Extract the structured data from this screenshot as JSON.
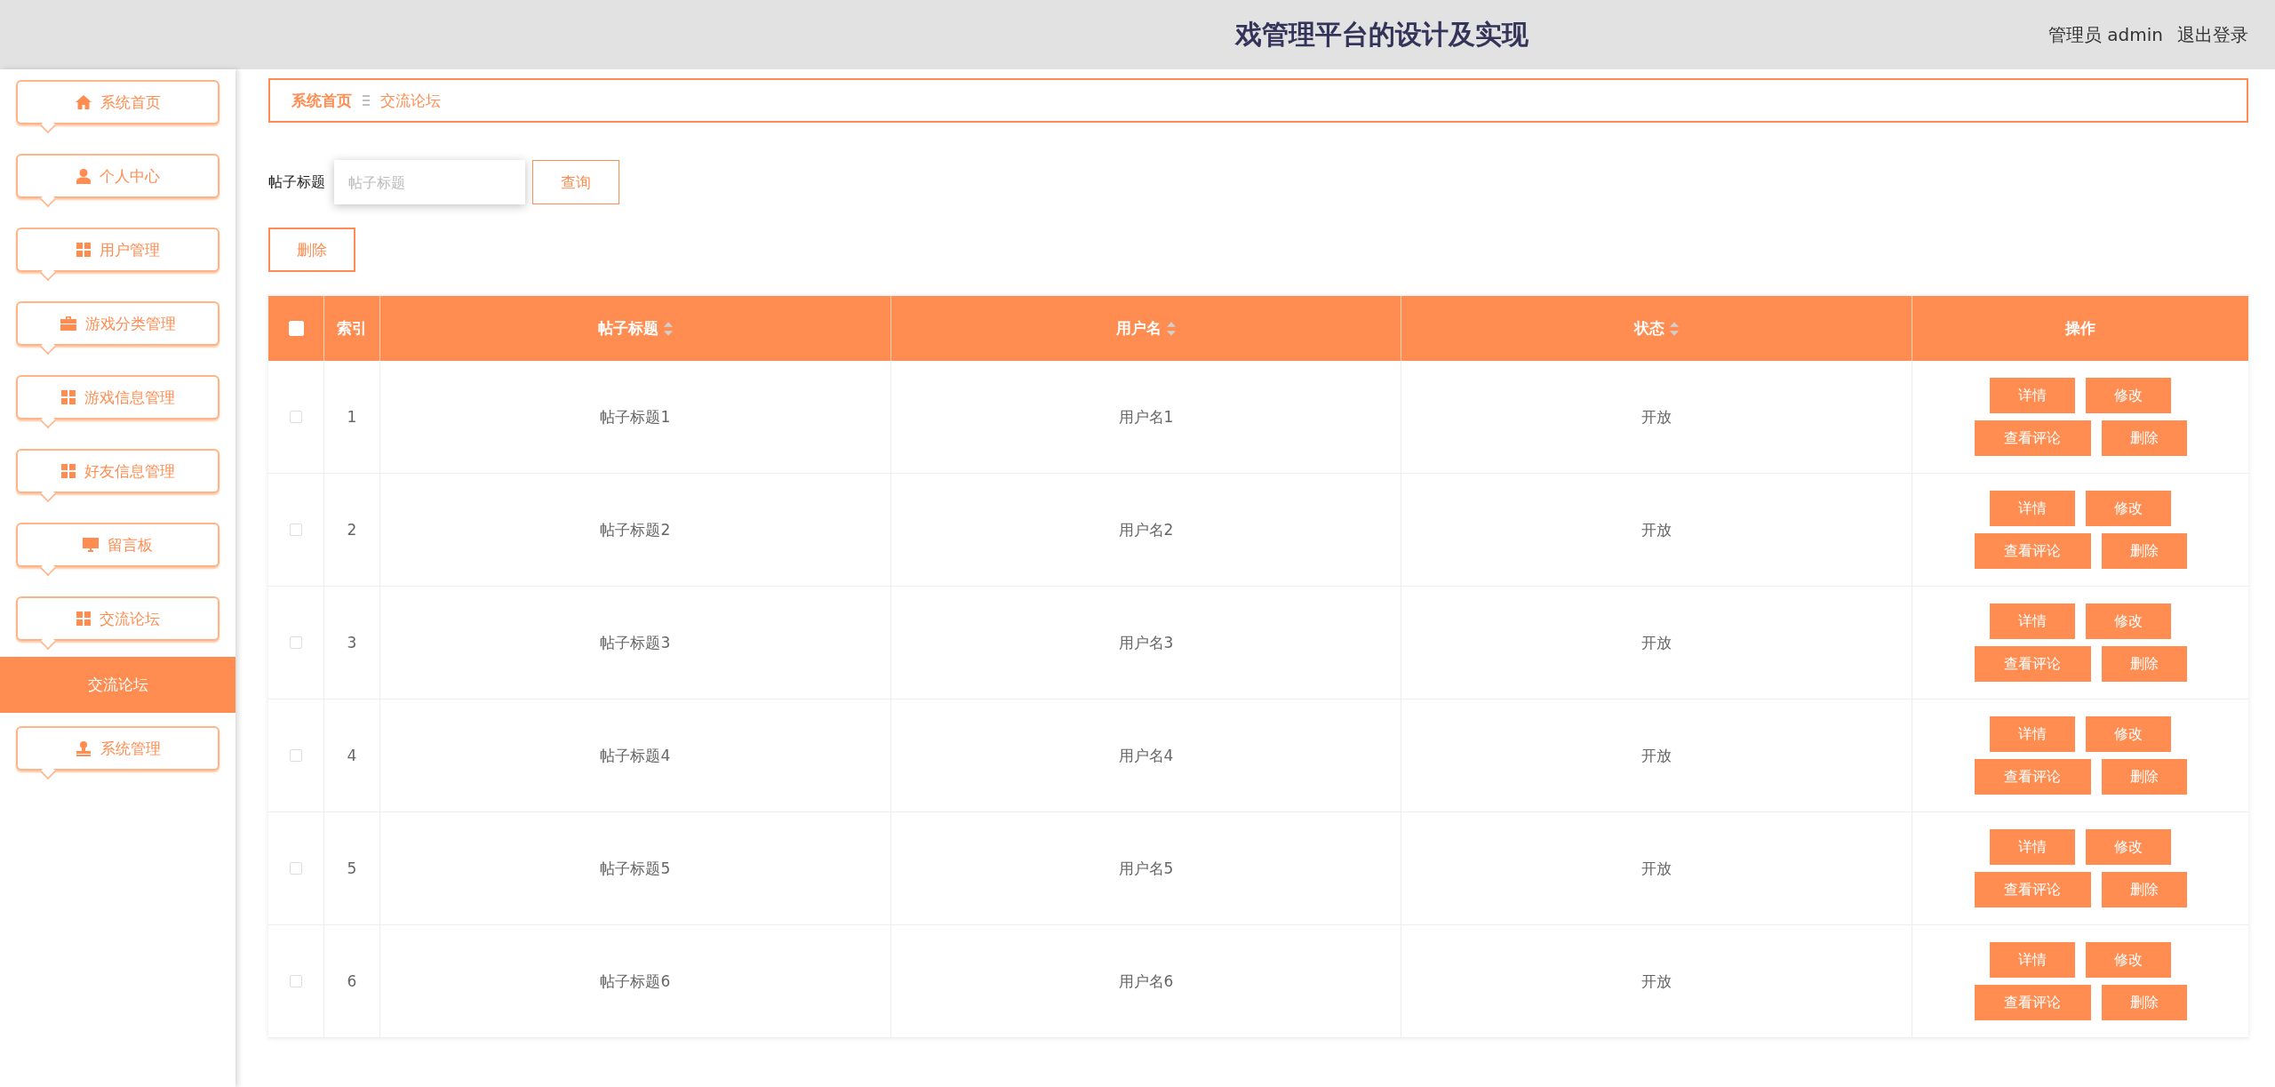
{
  "header": {
    "title": "戏管理平台的设计及实现",
    "user": "管理员 admin",
    "logout": "退出登录"
  },
  "sidebar": {
    "items": [
      {
        "label": "系统首页"
      },
      {
        "label": "个人中心"
      },
      {
        "label": "用户管理"
      },
      {
        "label": "游戏分类管理"
      },
      {
        "label": "游戏信息管理"
      },
      {
        "label": "好友信息管理"
      },
      {
        "label": "留言板"
      },
      {
        "label": "交流论坛",
        "children": [
          {
            "label": "交流论坛",
            "selected": true
          }
        ]
      },
      {
        "label": "系统管理"
      }
    ]
  },
  "breadcrumb": [
    "系统首页",
    "交流论坛"
  ],
  "search": {
    "label": "帖子标题",
    "placeholder": "帖子标题",
    "button": "查询"
  },
  "delete_button": "删除",
  "table": {
    "select_all": {
      "checked": false
    },
    "columns": [
      {
        "label": "索引",
        "sortable": false
      },
      {
        "label": "帖子标题",
        "sortable": true
      },
      {
        "label": "用户名",
        "sortable": true
      },
      {
        "label": "状态",
        "sortable": true
      },
      {
        "label": "操作",
        "sortable": false
      }
    ],
    "rows": [
      {
        "checked": false,
        "cells": [
          "1",
          "帖子标题1",
          "用户名1",
          "开放"
        ],
        "actions": [
          "详情",
          "修改",
          "查看评论",
          "删除"
        ]
      },
      {
        "checked": false,
        "cells": [
          "2",
          "帖子标题2",
          "用户名2",
          "开放"
        ],
        "actions": [
          "详情",
          "修改",
          "查看评论",
          "删除"
        ]
      },
      {
        "checked": false,
        "cells": [
          "3",
          "帖子标题3",
          "用户名3",
          "开放"
        ],
        "actions": [
          "详情",
          "修改",
          "查看评论",
          "删除"
        ]
      },
      {
        "checked": false,
        "cells": [
          "4",
          "帖子标题4",
          "用户名4",
          "开放"
        ],
        "actions": [
          "详情",
          "修改",
          "查看评论",
          "删除"
        ]
      },
      {
        "checked": false,
        "cells": [
          "5",
          "帖子标题5",
          "用户名5",
          "开放"
        ],
        "actions": [
          "详情",
          "修改",
          "查看评论",
          "删除"
        ]
      },
      {
        "checked": false,
        "cells": [
          "6",
          "帖子标题6",
          "用户名6",
          "开放"
        ],
        "actions": [
          "详情",
          "修改",
          "查看评论",
          "删除"
        ]
      }
    ]
  }
}
